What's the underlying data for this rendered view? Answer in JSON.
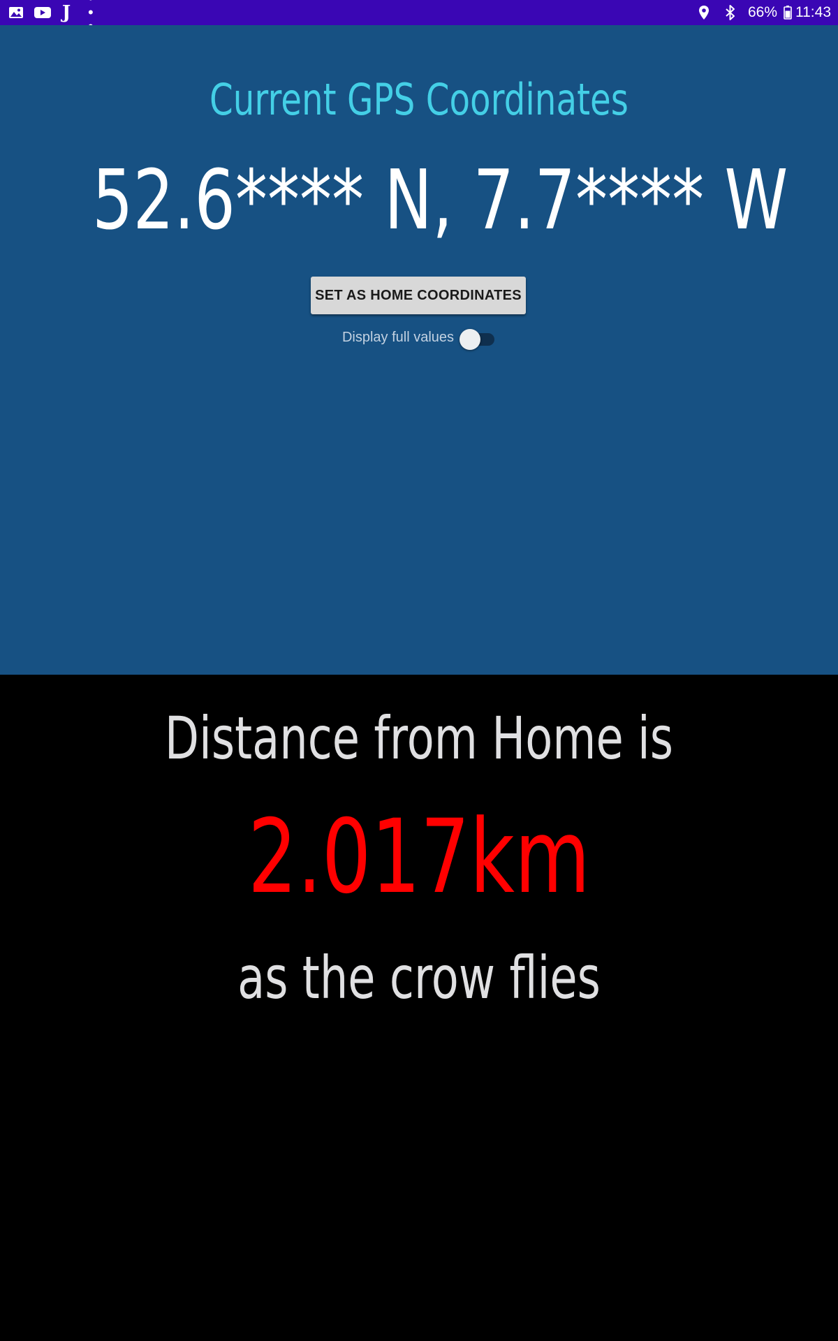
{
  "status_bar": {
    "left_icons": [
      "gallery-icon",
      "youtube-icon",
      "j-app-icon",
      "more-notifications-icon"
    ],
    "j_glyph": "J",
    "more_glyph": "• • •",
    "right_icons": [
      "location-icon",
      "bluetooth-icon",
      "battery-icon"
    ],
    "battery_percent": "66%",
    "time": "11:43",
    "background_color": "#3a06b4"
  },
  "gps": {
    "title": "Current GPS Coordinates",
    "coordinates": "52.6**** N, 7.7**** W",
    "set_home_button_label": "SET AS HOME COORDINATES",
    "display_full_values_label": "Display full values",
    "display_full_values_on": false,
    "background_color": "#175183",
    "title_color": "#44cfe6"
  },
  "distance": {
    "prefix": "Distance from Home is",
    "value": "2.017km",
    "suffix": "as the crow flies",
    "value_color": "#ff0000",
    "background_color": "#000000"
  }
}
